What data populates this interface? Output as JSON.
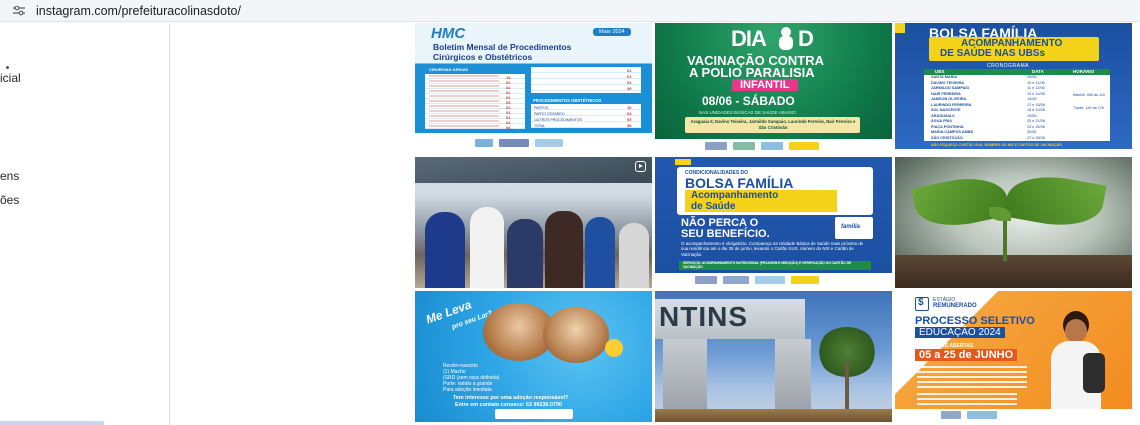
{
  "browser": {
    "url": "instagram.com/prefeituracolinasdoto/",
    "site_icon": "tune-icon"
  },
  "sidebar": {
    "items": [
      {
        "label": "icial"
      },
      {
        "label": "ens"
      },
      {
        "label": "ões"
      }
    ]
  },
  "posts": {
    "hmc": {
      "brand": "HMC",
      "date": "Maio 2024",
      "title": "Boletim Mensal de Procedimentos",
      "subtitle": "Cirúrgicos e Obstétricos",
      "left_header": "CIRURGIAS GERAIS",
      "right_header": "PROCEDIMENTOS OBSTÉTRICOS",
      "left_values": [
        "14",
        "02",
        "02",
        "01",
        "02",
        "03",
        "01",
        "01",
        "01",
        "02",
        "04"
      ],
      "right_values_top": [
        "01",
        "01",
        "01",
        "49"
      ],
      "right_rows": [
        "PARTOS",
        "PARTO CESÁREO",
        "OUTROS PROCEDIMENTOS",
        "TOTAL"
      ],
      "right_values_bottom": [
        "10",
        "04",
        "05",
        "38"
      ]
    },
    "polio": {
      "dia": "DIA",
      "d": "D",
      "line1": "VACINAÇÃO CONTRA",
      "line2": "A POLIO PARALISIA",
      "line3": "INFANTIL",
      "date": "08/06 - SÁBADO",
      "sub": "NAS UNIDADES BÁSICAS DE SAÚDE ABAIXO:",
      "places": "Araguaia II, Davino Teixeira, Jarmildo Sampaio, Laurindo Ferreira, Nair Ferreira e São Cristóvão"
    },
    "bolsa_crono": {
      "title": "BOLSA FAMÍLIA",
      "sub1": "ACOMPANHAMENTO",
      "sub2": "DE SAÚDE NAS UBSs",
      "cronograma": "CRONOGRAMA",
      "headers": [
        "UBS",
        "DATA",
        "HORÁRIO"
      ],
      "ubs": [
        "SANTA MARIA",
        "DAVINO TEIXEIRA",
        "JARMILDO SAMPAIO",
        "NAIR FERREIRA",
        "JAMSON OLIVEIRA",
        "LAURINDO FERREIRA",
        "SOL NASCENTE",
        "ARAGUAIA II",
        "ÁGUA FRIA",
        "PIAÇA PONTINHA",
        "MARIA CAMPOS AMBS",
        "SÃO CRISTÓVÃO"
      ],
      "dates": [
        "05/06",
        "10 e 11/06",
        "11 e 12/06",
        "13 e 14/06",
        "14/06",
        "17 e 18/06",
        "18 e 19/06",
        "19/06",
        "20 e 21/06",
        "24 e 25/06",
        "25/06",
        "27 e 28/06"
      ],
      "times": [
        "Manhã: 08h às 11h",
        "Tarde: 14h às 17h"
      ],
      "footer": "NÃO ESQUEÇA CARTÃO SUS, NÚMERO DO NIS E CARTÃO DE VACINAÇÃO"
    },
    "bolsa_benef": {
      "cond": "CONDICIONALIDADES DO",
      "title": "BOLSA FAMÍLIA",
      "sub1": "Acompanhamento",
      "sub2": "de Saúde",
      "headline1": "NÃO PERCA O",
      "headline2": "SEU BENEFÍCIO.",
      "body": "O acompanhamento é obrigatório. Compareça na Unidade Básica de Saúde mais próxima de sua residência até o dia 28 de junho, levando o Cartão SUS, número do NIS e Cartão de Vacinação.",
      "footer": "SERVIÇOS: ACOMPANHAMENTO NUTRICIONAL (PESAGEM E MEDIÇÃO) E VERIFICAÇÃO DO CARTÃO DE VACINAÇÃO",
      "familia": "família"
    },
    "adoption": {
      "title1": "Me Leva",
      "title2": "pro seu Lar?",
      "items": [
        "Recém-nascido",
        "(1) Macho",
        "(SRD (sem raça definida)",
        "Porte: médio a grande",
        "Para adoção imediata"
      ],
      "question": "Tem interesse por uma adoção responsável?",
      "contact": "Entre em contato conosco: 63 99236.0790"
    },
    "gate": {
      "sign": "NTINS"
    },
    "seletivo": {
      "brand1": "ESTÁGIO",
      "brand2": "REMUNERADO",
      "title1": "PROCESSO SELETIVO",
      "title2": "EDUCAÇÃO 2024",
      "inscricoes": "INSCRIÇÕES ABERTAS",
      "dates": "05 a 25 de JUNHO"
    }
  },
  "colors": {
    "sidebar_border": "#dbdbdb",
    "hmc_blue": "#1c8fd6",
    "polio_green": "#0f7a4a",
    "polio_pink": "#e6378d",
    "bolsa_blue": "#1b4fa0",
    "bolsa_yellow": "#f4d21a",
    "seletivo_orange": "#f28a1e"
  }
}
